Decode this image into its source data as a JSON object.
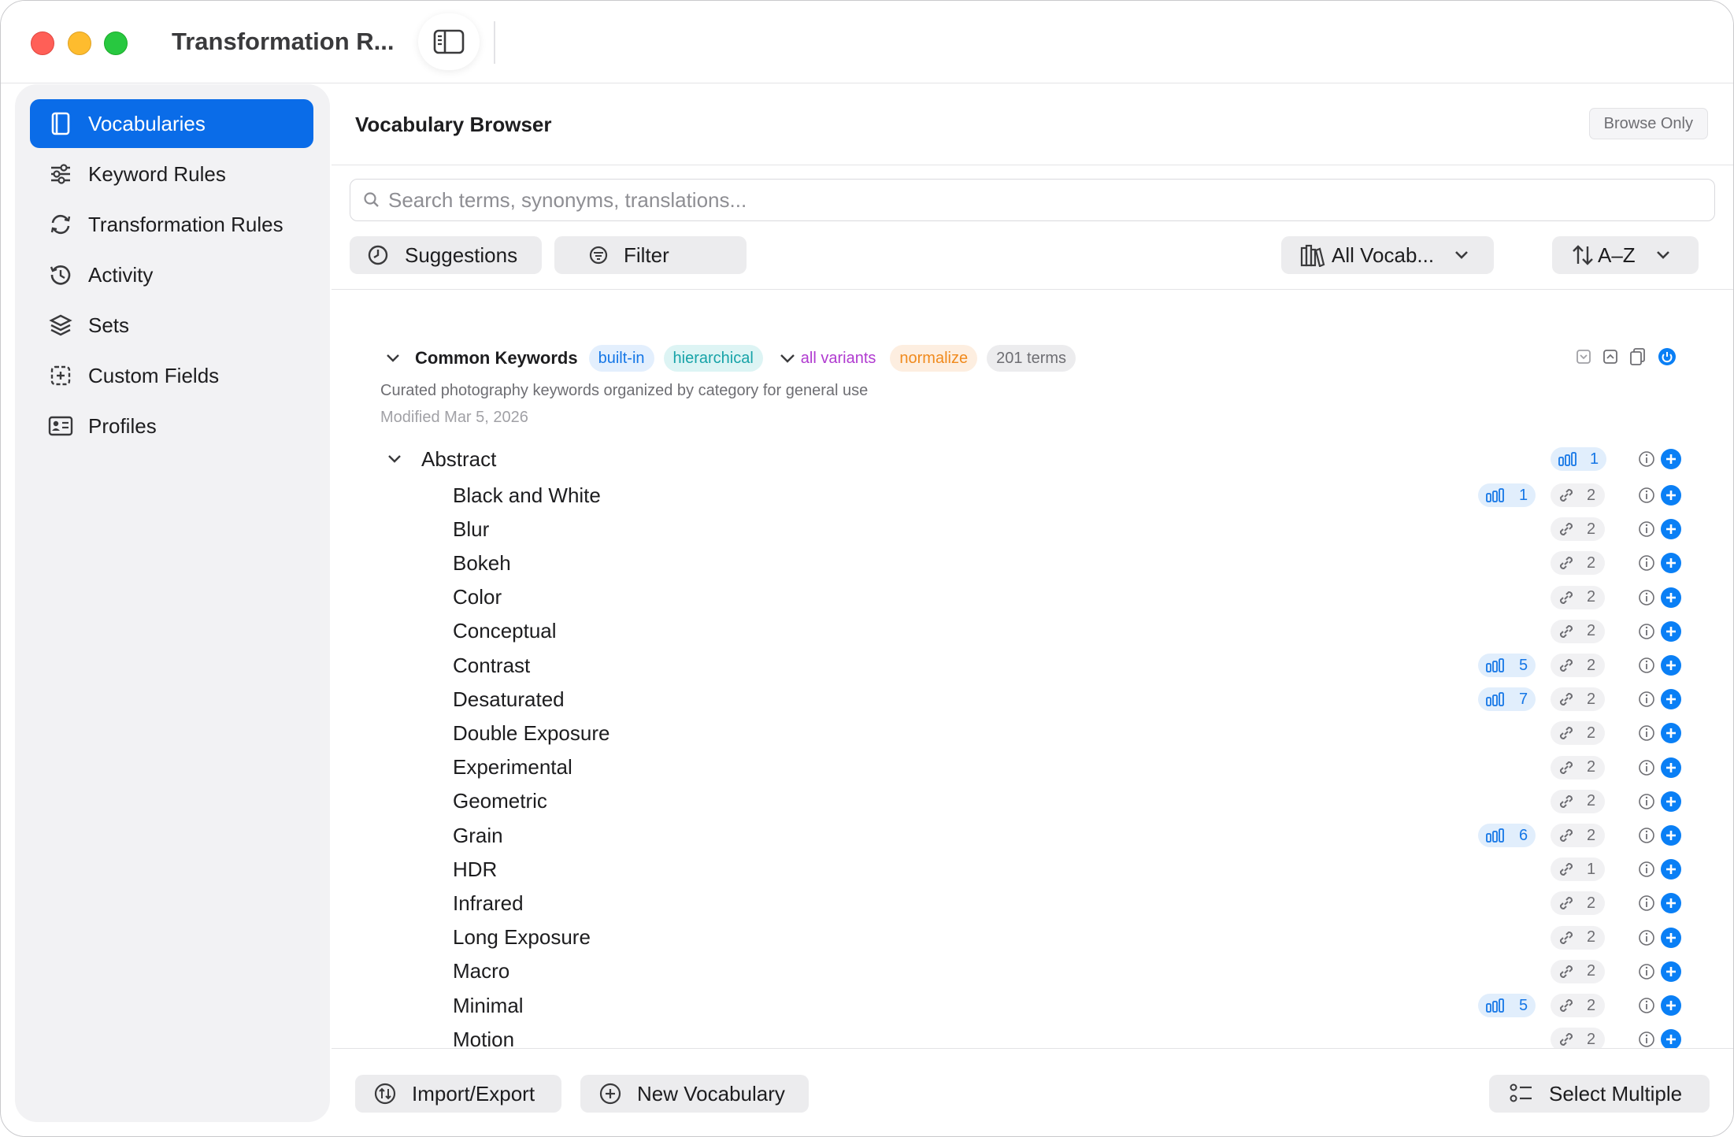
{
  "window": {
    "title": "Transformation R..."
  },
  "sidebar": {
    "items": [
      {
        "label": "Vocabularies",
        "icon": "book-icon",
        "active": true
      },
      {
        "label": "Keyword Rules",
        "icon": "sliders-icon",
        "active": false
      },
      {
        "label": "Transformation Rules",
        "icon": "refresh-icon",
        "active": false
      },
      {
        "label": "Activity",
        "icon": "history-icon",
        "active": false
      },
      {
        "label": "Sets",
        "icon": "layers-icon",
        "active": false
      },
      {
        "label": "Custom Fields",
        "icon": "field-plus-icon",
        "active": false
      },
      {
        "label": "Profiles",
        "icon": "id-card-icon",
        "active": false
      }
    ]
  },
  "header": {
    "title": "Vocabulary Browser",
    "mode_badge": "Browse Only"
  },
  "search": {
    "placeholder": "Search terms, synonyms, translations..."
  },
  "toolbar": {
    "suggestions_label": "Suggestions",
    "filter_label": "Filter",
    "vocab_select": "All Vocab...",
    "sort_select": "A–Z"
  },
  "group": {
    "name": "Common Keywords",
    "tags": {
      "builtin": "built-in",
      "hierarchical": "hierarchical",
      "variants": "all variants",
      "normalize": "normalize",
      "count": "201 terms"
    },
    "description": "Curated photography keywords organized by category for general use",
    "modified": "Modified Mar 5, 2026"
  },
  "category": {
    "label": "Abstract",
    "usage": "1"
  },
  "terms": [
    {
      "label": "Black and White",
      "usage": "1",
      "links": "2"
    },
    {
      "label": "Blur",
      "usage": "",
      "links": "2"
    },
    {
      "label": "Bokeh",
      "usage": "",
      "links": "2"
    },
    {
      "label": "Color",
      "usage": "",
      "links": "2"
    },
    {
      "label": "Conceptual",
      "usage": "",
      "links": "2"
    },
    {
      "label": "Contrast",
      "usage": "5",
      "links": "2"
    },
    {
      "label": "Desaturated",
      "usage": "7",
      "links": "2"
    },
    {
      "label": "Double Exposure",
      "usage": "",
      "links": "2"
    },
    {
      "label": "Experimental",
      "usage": "",
      "links": "2"
    },
    {
      "label": "Geometric",
      "usage": "",
      "links": "2"
    },
    {
      "label": "Grain",
      "usage": "6",
      "links": "2"
    },
    {
      "label": "HDR",
      "usage": "",
      "links": "1"
    },
    {
      "label": "Infrared",
      "usage": "",
      "links": "2"
    },
    {
      "label": "Long Exposure",
      "usage": "",
      "links": "2"
    },
    {
      "label": "Macro",
      "usage": "",
      "links": "2"
    },
    {
      "label": "Minimal",
      "usage": "5",
      "links": "2"
    },
    {
      "label": "Motion",
      "usage": "",
      "links": "2"
    }
  ],
  "footer": {
    "import_export_label": "Import/Export",
    "new_vocab_label": "New Vocabulary",
    "select_multiple_label": "Select Multiple"
  },
  "colors": {
    "accent": "#0a6ce8",
    "plus": "#0a7ff5"
  }
}
